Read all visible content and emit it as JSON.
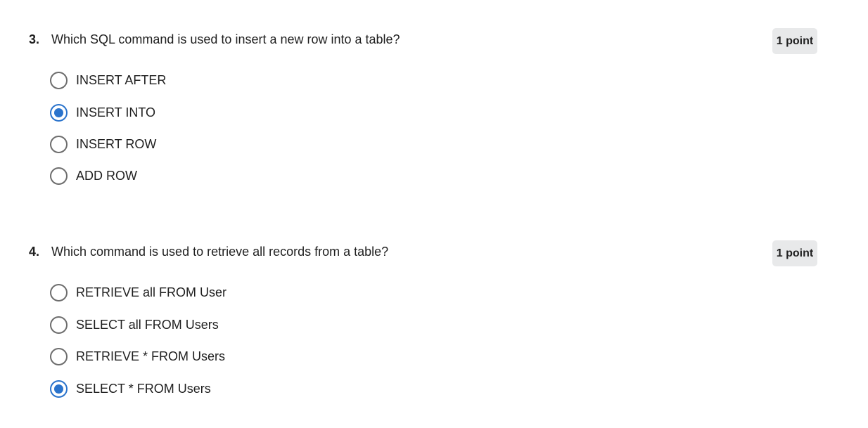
{
  "questions": [
    {
      "number": "3.",
      "text": "Which SQL command is used to insert a new row into a table?",
      "points": "1 point",
      "options": [
        {
          "label": "INSERT AFTER",
          "selected": false
        },
        {
          "label": "INSERT INTO",
          "selected": true
        },
        {
          "label": "INSERT ROW",
          "selected": false
        },
        {
          "label": "ADD ROW",
          "selected": false
        }
      ]
    },
    {
      "number": "4.",
      "text": "Which command is used to retrieve all records from a table?",
      "points": "1 point",
      "options": [
        {
          "label": "RETRIEVE all FROM User",
          "selected": false
        },
        {
          "label": "SELECT all FROM Users",
          "selected": false
        },
        {
          "label": "RETRIEVE * FROM Users",
          "selected": false
        },
        {
          "label": "SELECT * FROM Users",
          "selected": true
        }
      ]
    }
  ],
  "colors": {
    "accent": "#2a73cc",
    "radio_border": "#6d6d6d",
    "badge_bg": "#e8e9ea"
  }
}
